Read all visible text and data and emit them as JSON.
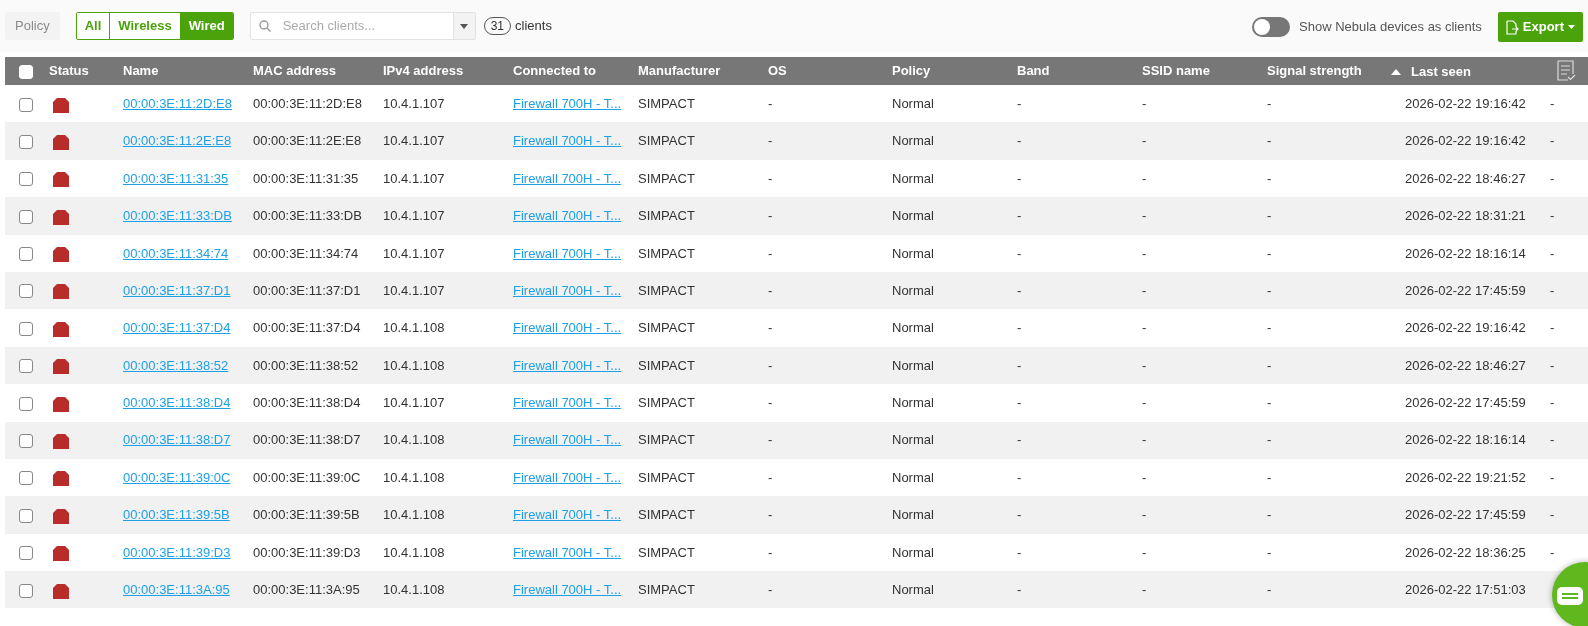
{
  "toolbar": {
    "policy_button": {
      "label": "Policy",
      "disabled": true
    },
    "filters": [
      {
        "label": "All",
        "selected": false
      },
      {
        "label": "Wireless",
        "selected": false
      },
      {
        "label": "Wired",
        "selected": true
      }
    ],
    "search": {
      "placeholder": "Search clients..."
    },
    "count": "31",
    "count_label": "clients",
    "toggle": {
      "label": "Show Nebula devices as clients",
      "on": false
    },
    "export_button": "Export"
  },
  "table": {
    "header_checkbox": {
      "checked": false
    },
    "columns": [
      {
        "label": "Status"
      },
      {
        "label": "Name"
      },
      {
        "label": "MAC address"
      },
      {
        "label": "IPv4 address"
      },
      {
        "label": "Connected to"
      },
      {
        "label": "Manufacturer"
      },
      {
        "label": "OS"
      },
      {
        "label": "Policy"
      },
      {
        "label": "Band"
      },
      {
        "label": "SSID name"
      },
      {
        "label": "Signal strength"
      },
      {
        "label": "Last seen",
        "sorted": true
      }
    ],
    "rows": [
      {
        "checked": false,
        "name": "00:00:3E:11:2D:E8",
        "mac": "00:00:3E:11:2D:E8",
        "ipv4": "10.4.1.107",
        "connected_to": "Firewall 700H - T...",
        "manufacturer": "SIMPACT",
        "os": "-",
        "policy": "Normal",
        "band": "-",
        "ssid": "-",
        "signal": "-",
        "last_seen": "2026-02-22 19:16:42",
        "column_14": "-"
      },
      {
        "checked": false,
        "name": "00:00:3E:11:2E:E8",
        "mac": "00:00:3E:11:2E:E8",
        "ipv4": "10.4.1.107",
        "connected_to": "Firewall 700H - T...",
        "manufacturer": "SIMPACT",
        "os": "-",
        "policy": "Normal",
        "band": "-",
        "ssid": "-",
        "signal": "-",
        "last_seen": "2026-02-22 19:16:42",
        "column_14": "-"
      },
      {
        "checked": false,
        "name": "00:00:3E:11:31:35",
        "mac": "00:00:3E:11:31:35",
        "ipv4": "10.4.1.107",
        "connected_to": "Firewall 700H - T...",
        "manufacturer": "SIMPACT",
        "os": "-",
        "policy": "Normal",
        "band": "-",
        "ssid": "-",
        "signal": "-",
        "last_seen": "2026-02-22 18:46:27",
        "column_14": "-"
      },
      {
        "checked": false,
        "name": "00:00:3E:11:33:DB",
        "mac": "00:00:3E:11:33:DB",
        "ipv4": "10.4.1.107",
        "connected_to": "Firewall 700H - T...",
        "manufacturer": "SIMPACT",
        "os": "-",
        "policy": "Normal",
        "band": "-",
        "ssid": "-",
        "signal": "-",
        "last_seen": "2026-02-22 18:31:21",
        "column_14": "-"
      },
      {
        "checked": false,
        "name": "00:00:3E:11:34:74",
        "mac": "00:00:3E:11:34:74",
        "ipv4": "10.4.1.107",
        "connected_to": "Firewall 700H - T...",
        "manufacturer": "SIMPACT",
        "os": "-",
        "policy": "Normal",
        "band": "-",
        "ssid": "-",
        "signal": "-",
        "last_seen": "2026-02-22 18:16:14",
        "column_14": "-"
      },
      {
        "checked": false,
        "name": "00:00:3E:11:37:D1",
        "mac": "00:00:3E:11:37:D1",
        "ipv4": "10.4.1.107",
        "connected_to": "Firewall 700H - T...",
        "manufacturer": "SIMPACT",
        "os": "-",
        "policy": "Normal",
        "band": "-",
        "ssid": "-",
        "signal": "-",
        "last_seen": "2026-02-22 17:45:59",
        "column_14": "-"
      },
      {
        "checked": false,
        "name": "00:00:3E:11:37:D4",
        "mac": "00:00:3E:11:37:D4",
        "ipv4": "10.4.1.108",
        "connected_to": "Firewall 700H - T...",
        "manufacturer": "SIMPACT",
        "os": "-",
        "policy": "Normal",
        "band": "-",
        "ssid": "-",
        "signal": "-",
        "last_seen": "2026-02-22 19:16:42",
        "column_14": "-"
      },
      {
        "checked": false,
        "name": "00:00:3E:11:38:52",
        "mac": "00:00:3E:11:38:52",
        "ipv4": "10.4.1.108",
        "connected_to": "Firewall 700H - T...",
        "manufacturer": "SIMPACT",
        "os": "-",
        "policy": "Normal",
        "band": "-",
        "ssid": "-",
        "signal": "-",
        "last_seen": "2026-02-22 18:46:27",
        "column_14": "-"
      },
      {
        "checked": false,
        "name": "00:00:3E:11:38:D4",
        "mac": "00:00:3E:11:38:D4",
        "ipv4": "10.4.1.107",
        "connected_to": "Firewall 700H - T...",
        "manufacturer": "SIMPACT",
        "os": "-",
        "policy": "Normal",
        "band": "-",
        "ssid": "-",
        "signal": "-",
        "last_seen": "2026-02-22 17:45:59",
        "column_14": "-"
      },
      {
        "checked": false,
        "name": "00:00:3E:11:38:D7",
        "mac": "00:00:3E:11:38:D7",
        "ipv4": "10.4.1.108",
        "connected_to": "Firewall 700H - T...",
        "manufacturer": "SIMPACT",
        "os": "-",
        "policy": "Normal",
        "band": "-",
        "ssid": "-",
        "signal": "-",
        "last_seen": "2026-02-22 18:16:14",
        "column_14": "-"
      },
      {
        "checked": false,
        "name": "00:00:3E:11:39:0C",
        "mac": "00:00:3E:11:39:0C",
        "ipv4": "10.4.1.108",
        "connected_to": "Firewall 700H - T...",
        "manufacturer": "SIMPACT",
        "os": "-",
        "policy": "Normal",
        "band": "-",
        "ssid": "-",
        "signal": "-",
        "last_seen": "2026-02-22 19:21:52",
        "column_14": "-"
      },
      {
        "checked": false,
        "name": "00:00:3E:11:39:5B",
        "mac": "00:00:3E:11:39:5B",
        "ipv4": "10.4.1.108",
        "connected_to": "Firewall 700H - T...",
        "manufacturer": "SIMPACT",
        "os": "-",
        "policy": "Normal",
        "band": "-",
        "ssid": "-",
        "signal": "-",
        "last_seen": "2026-02-22 17:45:59",
        "column_14": "-"
      },
      {
        "checked": false,
        "name": "00:00:3E:11:39:D3",
        "mac": "00:00:3E:11:39:D3",
        "ipv4": "10.4.1.108",
        "connected_to": "Firewall 700H - T...",
        "manufacturer": "SIMPACT",
        "os": "-",
        "policy": "Normal",
        "band": "-",
        "ssid": "-",
        "signal": "-",
        "last_seen": "2026-02-22 18:36:25",
        "column_14": "-"
      },
      {
        "checked": false,
        "name": "00:00:3E:11:3A:95",
        "mac": "00:00:3E:11:3A:95",
        "ipv4": "10.4.1.108",
        "connected_to": "Firewall 700H - T...",
        "manufacturer": "SIMPACT",
        "os": "-",
        "policy": "Normal",
        "band": "-",
        "ssid": "-",
        "signal": "-",
        "last_seen": "2026-02-22 17:51:03"
      }
    ]
  }
}
